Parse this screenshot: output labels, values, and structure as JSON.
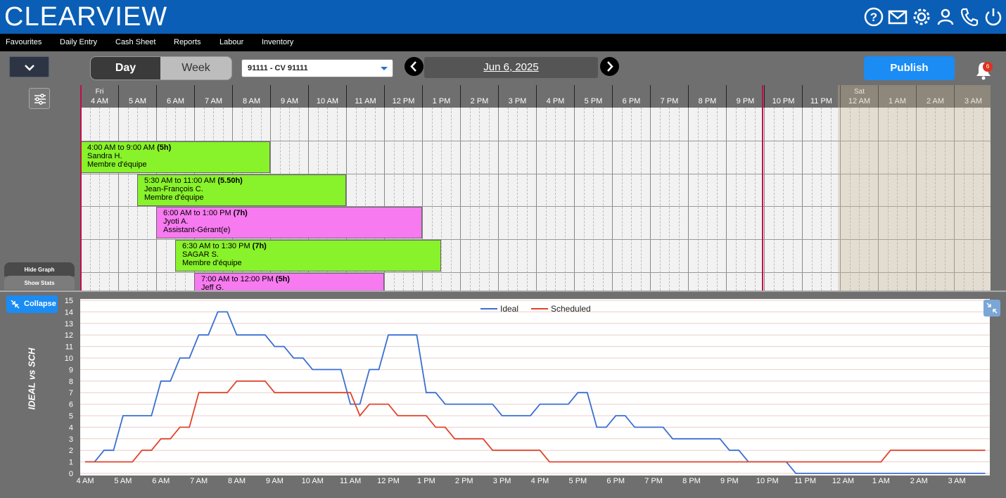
{
  "header": {
    "logo": "CLEARVIEW",
    "icons": [
      "help-icon",
      "mail-icon",
      "settings-icon",
      "user-icon",
      "phone-icon",
      "power-icon"
    ]
  },
  "menu": [
    "Favourites",
    "Daily Entry",
    "Cash Sheet",
    "Reports",
    "Labour",
    "Inventory"
  ],
  "toolbar": {
    "view_day": "Day",
    "view_week": "Week",
    "store": "91111 - CV 91111",
    "date": "Jun 6, 2025",
    "publish": "Publish",
    "notification_count": "6"
  },
  "grid": {
    "hours": [
      {
        "day": "Fri",
        "label": "4 AM"
      },
      {
        "day": "",
        "label": "5 AM"
      },
      {
        "day": "",
        "label": "6 AM"
      },
      {
        "day": "",
        "label": "7 AM"
      },
      {
        "day": "",
        "label": "8 AM"
      },
      {
        "day": "",
        "label": "9 AM"
      },
      {
        "day": "",
        "label": "10 AM"
      },
      {
        "day": "",
        "label": "11 AM"
      },
      {
        "day": "",
        "label": "12 PM"
      },
      {
        "day": "",
        "label": "1 PM"
      },
      {
        "day": "",
        "label": "2 PM"
      },
      {
        "day": "",
        "label": "3 PM"
      },
      {
        "day": "",
        "label": "4 PM"
      },
      {
        "day": "",
        "label": "5 PM"
      },
      {
        "day": "",
        "label": "6 PM"
      },
      {
        "day": "",
        "label": "7 PM"
      },
      {
        "day": "",
        "label": "8 PM"
      },
      {
        "day": "",
        "label": "9 PM"
      },
      {
        "day": "",
        "label": "10 PM"
      },
      {
        "day": "",
        "label": "11 PM"
      },
      {
        "day": "Sat",
        "label": "12 AM"
      },
      {
        "day": "",
        "label": "1 AM"
      },
      {
        "day": "",
        "label": "2 AM"
      },
      {
        "day": "",
        "label": "3 AM"
      }
    ],
    "shifts": [
      {
        "time": "4:00 AM to 9:00 AM",
        "hours": "(5h)",
        "name": "Sandra H.",
        "role": "Membre d'équipe",
        "color": "green",
        "start": 4.0,
        "end": 9.0
      },
      {
        "time": "5:30 AM to 11:00 AM",
        "hours": "(5.50h)",
        "name": "Jean-François C.",
        "role": "Membre d'équipe",
        "color": "green",
        "start": 5.5,
        "end": 11.0
      },
      {
        "time": "6:00 AM to 1:00 PM",
        "hours": "(7h)",
        "name": "Jyoti A.",
        "role": "Assistant-Gérant(e)",
        "color": "pink",
        "start": 6.0,
        "end": 13.0
      },
      {
        "time": "6:30 AM to 1:30 PM",
        "hours": "(7h)",
        "name": "SAGAR S.",
        "role": "Membre d'équipe",
        "color": "green",
        "start": 6.5,
        "end": 13.5
      },
      {
        "time": "7:00 AM to 12:00 PM",
        "hours": "(5h)",
        "name": "Jeff G.",
        "role": "",
        "color": "pink",
        "start": 7.0,
        "end": 12.0
      }
    ]
  },
  "side": {
    "hide_graph": "Hide Graph",
    "show_stats": "Show Stats",
    "collapse": "Collapse"
  },
  "chart_data": {
    "type": "line",
    "ylabel": "IDEAL vs SCH",
    "ylim": [
      0,
      15
    ],
    "legend_position": "top-center",
    "x_tick_labels": [
      "4 AM",
      "5 AM",
      "6 AM",
      "7 AM",
      "8 AM",
      "9 AM",
      "10 AM",
      "11 AM",
      "12 PM",
      "1 PM",
      "2 PM",
      "3 PM",
      "4 PM",
      "5 PM",
      "6 PM",
      "7 PM",
      "8 PM",
      "9 PM",
      "10 PM",
      "11 PM",
      "12 AM",
      "1 AM",
      "2 AM",
      "3 AM"
    ],
    "x_hours": [
      4.0,
      4.25,
      4.5,
      4.75,
      5.0,
      5.25,
      5.5,
      5.75,
      6.0,
      6.25,
      6.5,
      6.75,
      7.0,
      7.25,
      7.5,
      7.75,
      8.0,
      8.25,
      8.5,
      8.75,
      9.0,
      9.25,
      9.5,
      9.75,
      10.0,
      10.25,
      10.5,
      10.75,
      11.0,
      11.25,
      11.5,
      11.75,
      12.0,
      12.25,
      12.5,
      12.75,
      13.0,
      13.25,
      13.5,
      13.75,
      14.0,
      14.25,
      14.5,
      14.75,
      15.0,
      15.25,
      15.5,
      15.75,
      16.0,
      16.25,
      16.5,
      16.75,
      17.0,
      17.25,
      17.5,
      17.75,
      18.0,
      18.25,
      18.5,
      18.75,
      19.0,
      19.25,
      19.5,
      19.75,
      20.0,
      20.25,
      20.5,
      20.75,
      21.0,
      21.25,
      21.5,
      21.75,
      22.0,
      22.25,
      22.5,
      22.75,
      23.0,
      23.25,
      23.5,
      23.75,
      24.0,
      24.25,
      24.5,
      24.75,
      25.0,
      25.25,
      25.5,
      25.75,
      26.0,
      26.25,
      26.5,
      26.75,
      27.0,
      27.25,
      27.5,
      27.75
    ],
    "series": [
      {
        "name": "Ideal",
        "color": "#3a6fd0",
        "values": [
          1,
          1,
          2,
          2,
          5,
          5,
          5,
          5,
          8,
          8,
          10,
          10,
          12,
          12,
          14,
          14,
          12,
          12,
          12,
          12,
          11,
          11,
          10,
          10,
          9,
          9,
          9,
          9,
          6,
          6,
          9,
          9,
          12,
          12,
          12,
          12,
          7,
          7,
          6,
          6,
          6,
          6,
          6,
          6,
          5,
          5,
          5,
          5,
          6,
          6,
          6,
          6,
          7,
          7,
          4,
          4,
          5,
          5,
          4,
          4,
          4,
          4,
          3,
          3,
          3,
          3,
          3,
          3,
          2,
          2,
          1,
          1,
          1,
          1,
          1,
          0,
          0,
          0,
          0,
          0,
          0,
          0,
          0,
          0,
          0,
          0,
          0,
          0,
          0,
          0,
          0,
          0,
          0,
          0,
          0,
          0
        ]
      },
      {
        "name": "Scheduled",
        "color": "#e0442a",
        "values": [
          1,
          1,
          1,
          1,
          1,
          1,
          2,
          2,
          3,
          3,
          4,
          4,
          7,
          7,
          7,
          7,
          8,
          8,
          8,
          8,
          7,
          7,
          7,
          7,
          7,
          7,
          7,
          7,
          7,
          5,
          6,
          6,
          6,
          5,
          5,
          5,
          5,
          4,
          4,
          3,
          3,
          3,
          3,
          2,
          2,
          2,
          2,
          2,
          2,
          1,
          1,
          1,
          1,
          1,
          1,
          1,
          1,
          1,
          1,
          1,
          1,
          1,
          1,
          1,
          1,
          1,
          1,
          1,
          1,
          1,
          1,
          1,
          1,
          1,
          1,
          1,
          1,
          1,
          1,
          1,
          1,
          1,
          1,
          1,
          1,
          2,
          2,
          2,
          2,
          2,
          2,
          2,
          2,
          2,
          2,
          2
        ]
      }
    ]
  }
}
